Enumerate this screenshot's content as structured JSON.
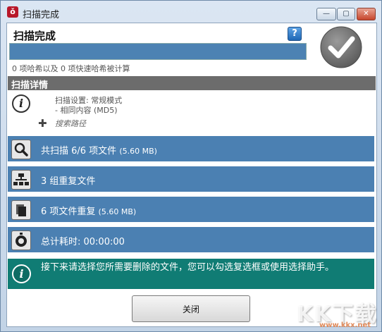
{
  "window": {
    "title": "扫描完成",
    "controls": {
      "minimize": "—",
      "maximize": "▢",
      "close": "✕"
    }
  },
  "header": {
    "title": "扫描完成",
    "help_glyph": "?",
    "status_icon": "checkmark-circle-icon",
    "progress": 1.0,
    "hash_info": "0 项哈希以及 0 项快速哈希被计算"
  },
  "details": {
    "section_title": "扫描详情",
    "scan_setting": "扫描设置: 常规模式",
    "compare_mode": "- 相同内容 (MD5)",
    "search_path_label": "搜索路径"
  },
  "summary_rows": [
    {
      "icon": "magnifier-icon",
      "text": "共扫描 6/6 项文件",
      "extra": "(5.60 MB)"
    },
    {
      "icon": "group-tree-icon",
      "text": "3 组重复文件",
      "extra": ""
    },
    {
      "icon": "document-copy-icon",
      "text": "6 项文件重复",
      "extra": "(5.60 MB)"
    },
    {
      "icon": "stopwatch-icon",
      "text": "总计耗时: 00:00:00",
      "extra": ""
    }
  ],
  "notice": {
    "glyph": "i",
    "text": "接下来请选择您所需要删除的文件，您可以勾选复选框或使用选择助手。"
  },
  "buttons": {
    "close": "关闭"
  },
  "watermark": {
    "logo": "KK下载",
    "url": "www.kkx.net"
  },
  "colors": {
    "row_blue": "#4b80b2",
    "notice_teal": "#107c74",
    "section_gray": "#6c6c6c"
  }
}
